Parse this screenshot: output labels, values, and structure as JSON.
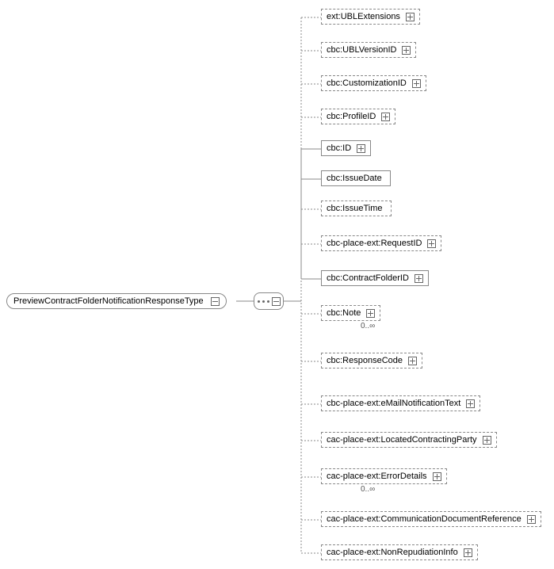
{
  "root": {
    "label": "PreviewContractFolderNotificationResponseType"
  },
  "children": [
    {
      "label": "ext:UBLExtensions",
      "optional": true,
      "expandable": true,
      "cardinality": null
    },
    {
      "label": "cbc:UBLVersionID",
      "optional": true,
      "expandable": true,
      "cardinality": null
    },
    {
      "label": "cbc:CustomizationID",
      "optional": true,
      "expandable": true,
      "cardinality": null
    },
    {
      "label": "cbc:ProfileID",
      "optional": true,
      "expandable": true,
      "cardinality": null
    },
    {
      "label": "cbc:ID",
      "optional": false,
      "expandable": true,
      "cardinality": null
    },
    {
      "label": "cbc:IssueDate",
      "optional": false,
      "expandable": false,
      "cardinality": null
    },
    {
      "label": "cbc:IssueTime",
      "optional": true,
      "expandable": false,
      "cardinality": null
    },
    {
      "label": "cbc-place-ext:RequestID",
      "optional": true,
      "expandable": true,
      "cardinality": null
    },
    {
      "label": "cbc:ContractFolderID",
      "optional": false,
      "expandable": true,
      "cardinality": null
    },
    {
      "label": "cbc:Note",
      "optional": true,
      "expandable": true,
      "cardinality": "0..∞"
    },
    {
      "label": "cbc:ResponseCode",
      "optional": true,
      "expandable": true,
      "cardinality": null
    },
    {
      "label": "cbc-place-ext:eMailNotificationText",
      "optional": true,
      "expandable": true,
      "cardinality": null
    },
    {
      "label": "cac-place-ext:LocatedContractingParty",
      "optional": true,
      "expandable": true,
      "cardinality": null
    },
    {
      "label": "cac-place-ext:ErrorDetails",
      "optional": true,
      "expandable": true,
      "cardinality": "0..∞"
    },
    {
      "label": "cac-place-ext:CommunicationDocumentReference",
      "optional": true,
      "expandable": true,
      "cardinality": null
    },
    {
      "label": "cac-place-ext:NonRepudiationInfo",
      "optional": true,
      "expandable": true,
      "cardinality": null
    }
  ],
  "chart_data": {
    "type": "tree",
    "title": "PreviewContractFolderNotificationResponseType XSD schema",
    "root": "PreviewContractFolderNotificationResponseType",
    "compositor": "sequence",
    "elements": [
      {
        "name": "ext:UBLExtensions",
        "min": 0,
        "max": 1,
        "complex": true
      },
      {
        "name": "cbc:UBLVersionID",
        "min": 0,
        "max": 1,
        "complex": true
      },
      {
        "name": "cbc:CustomizationID",
        "min": 0,
        "max": 1,
        "complex": true
      },
      {
        "name": "cbc:ProfileID",
        "min": 0,
        "max": 1,
        "complex": true
      },
      {
        "name": "cbc:ID",
        "min": 1,
        "max": 1,
        "complex": true
      },
      {
        "name": "cbc:IssueDate",
        "min": 1,
        "max": 1,
        "complex": false
      },
      {
        "name": "cbc:IssueTime",
        "min": 0,
        "max": 1,
        "complex": false
      },
      {
        "name": "cbc-place-ext:RequestID",
        "min": 0,
        "max": 1,
        "complex": true
      },
      {
        "name": "cbc:ContractFolderID",
        "min": 1,
        "max": 1,
        "complex": true
      },
      {
        "name": "cbc:Note",
        "min": 0,
        "max": "unbounded",
        "complex": true
      },
      {
        "name": "cbc:ResponseCode",
        "min": 0,
        "max": 1,
        "complex": true
      },
      {
        "name": "cbc-place-ext:eMailNotificationText",
        "min": 0,
        "max": 1,
        "complex": true
      },
      {
        "name": "cac-place-ext:LocatedContractingParty",
        "min": 0,
        "max": 1,
        "complex": true
      },
      {
        "name": "cac-place-ext:ErrorDetails",
        "min": 0,
        "max": "unbounded",
        "complex": true
      },
      {
        "name": "cac-place-ext:CommunicationDocumentReference",
        "min": 0,
        "max": 1,
        "complex": true
      },
      {
        "name": "cac-place-ext:NonRepudiationInfo",
        "min": 0,
        "max": 1,
        "complex": true
      }
    ]
  }
}
